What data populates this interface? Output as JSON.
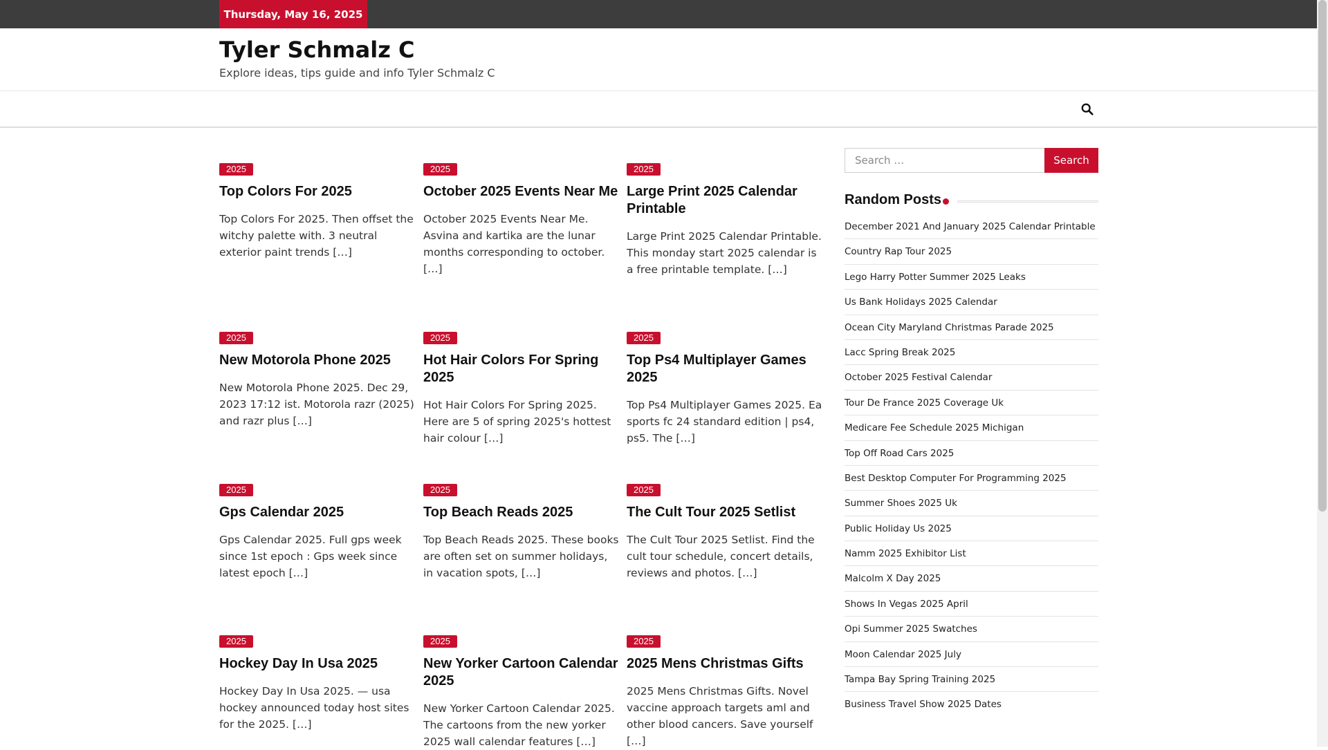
{
  "topbar": {
    "date": "Thursday, May 16, 2025"
  },
  "site": {
    "title": "Tyler Schmalz C",
    "description": "Explore ideas, tips guide and info Tyler Schmalz C"
  },
  "nav": {
    "search_icon": "search-icon"
  },
  "posts": [
    {
      "category": "2025",
      "title": "Top Colors For 2025",
      "excerpt": "Top Colors For 2025. Then offset the witchy palette with. 3 neutral exterior paint trends […]"
    },
    {
      "category": "2025",
      "title": "October 2025 Events Near Me",
      "excerpt": "October 2025 Events Near Me. Asvina and kartika are the lunar months corresponding to october. […]"
    },
    {
      "category": "2025",
      "title": "Large Print 2025 Calendar Printable",
      "excerpt": "Large Print 2025 Calendar Printable. This monday start 2025 calendar is a free printable template. […]"
    },
    {
      "category": "2025",
      "title": "New Motorola Phone 2025",
      "excerpt": "New Motorola Phone 2025. Dec 29, 2023 17:12 ist. Motorola razr (2025) and razr plus […]"
    },
    {
      "category": "2025",
      "title": "Hot Hair Colors For Spring 2025",
      "excerpt": "Hot Hair Colors For Spring 2025. Here are 5 of spring 2025's hottest hair colour […]"
    },
    {
      "category": "2025",
      "title": "Top Ps4 Multiplayer Games 2025",
      "excerpt": "Top Ps4 Multiplayer Games 2025. Ea sports fc 24 standard edition | ps4, ps5. The […]"
    },
    {
      "category": "2025",
      "title": "Gps Calendar 2025",
      "excerpt": "Gps Calendar 2025. Full gps week since 1st epoch : Gps week since latest epoch […]"
    },
    {
      "category": "2025",
      "title": "Top Beach Reads 2025",
      "excerpt": "Top Beach Reads 2025. These books are often set on summer holidays, in vacation spots, […]"
    },
    {
      "category": "2025",
      "title": "The Cult Tour 2025 Setlist",
      "excerpt": "The Cult Tour 2025 Setlist. Find the cult tour schedule, concert details, reviews and photos. […]"
    },
    {
      "category": "2025",
      "title": "Hockey Day In Usa 2025",
      "excerpt": "Hockey Day In Usa 2025. — usa hockey announced today host sites for the 2025. […]"
    },
    {
      "category": "2025",
      "title": "New Yorker Cartoon Calendar 2025",
      "excerpt": "New Yorker Cartoon Calendar 2025. The cartoons from the new yorker 2025 wall calendar features […]"
    },
    {
      "category": "2025",
      "title": "2025 Mens Christmas Gifts",
      "excerpt": "2025 Mens Christmas Gifts. Novel vaccine approach targets aml and other blood cancers. Save yourself […]"
    }
  ],
  "sidebar": {
    "search_placeholder": "Search …",
    "search_button": "Search",
    "random_title": "Random Posts",
    "random_posts": [
      "December 2021 And January 2025 Calendar Printable",
      "Country Rap Tour 2025",
      "Lego Harry Potter Summer 2025 Leaks",
      "Us Bank Holidays 2025 Calendar",
      "Ocean City Maryland Christmas Parade 2025",
      "Lacc Spring Break 2025",
      "October 2025 Festival Calendar",
      "Tour De France 2025 Coverage Uk",
      "Medicare Fee Schedule 2025 Michigan",
      "Top Off Road Cars 2025",
      "Best Desktop Computer For Programming 2025",
      "Summer Shoes 2025 Uk",
      "Public Holiday Us 2025",
      "Namm 2025 Exhibitor List",
      "Malcolm X Day 2025",
      "Shows In Vegas 2025 April",
      "Opi Summer 2025 Swatches",
      "Moon Calendar 2025 July",
      "Tampa Bay Spring Training 2025",
      "Business Travel Show 2025 Dates"
    ]
  },
  "colors": {
    "accent": "#c8102e",
    "topbar": "#3d3d3d"
  }
}
